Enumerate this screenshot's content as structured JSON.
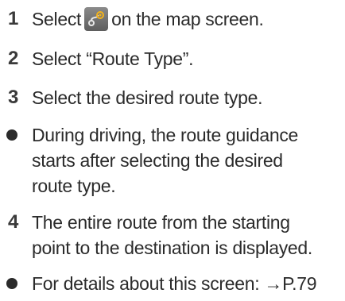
{
  "steps": [
    {
      "number": "1",
      "before": "Select",
      "icon": "route-menu-icon",
      "after": "on the map screen."
    },
    {
      "number": "2",
      "text": "Select “Route Type”."
    },
    {
      "number": "3",
      "text": "Select the desired route type."
    },
    {
      "number": "4",
      "lines": [
        "The entire route from the starting",
        "point to the destination is displayed."
      ]
    }
  ],
  "notes": [
    {
      "lines": [
        "During driving, the route guidance",
        "starts after selecting the desired",
        "route type."
      ]
    },
    {
      "text": "For details about this screen: →P.79"
    }
  ]
}
